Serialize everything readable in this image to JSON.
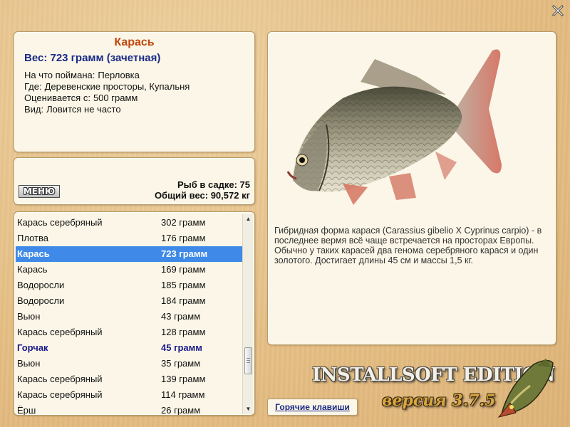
{
  "info": {
    "fish_name": "Карась",
    "weight_line": "Вес: 723 грамм (зачетная)",
    "details": [
      {
        "label": "На что поймана:",
        "value": "Перловка"
      },
      {
        "label": "Где:",
        "value": "Деревенские просторы, Купальня"
      },
      {
        "label": "Оценивается с:",
        "value": "500 грамм"
      },
      {
        "label": "Вид:",
        "value": "Ловится не часто"
      }
    ]
  },
  "stats": {
    "menu_label": "МЕНЮ",
    "keep_net": "Рыб в садке: 75",
    "total_weight": "Общий вес: 90,572 кг"
  },
  "catch_list": [
    {
      "name": "Карась серебряный",
      "weight": "302 грамм",
      "style": "normal"
    },
    {
      "name": "Плотва",
      "weight": "176 грамм",
      "style": "normal"
    },
    {
      "name": "Карась",
      "weight": "723 грамм",
      "style": "selected"
    },
    {
      "name": "Карась",
      "weight": "169 грамм",
      "style": "normal"
    },
    {
      "name": "Водоросли",
      "weight": "185 грамм",
      "style": "normal"
    },
    {
      "name": "Водоросли",
      "weight": "184 грамм",
      "style": "normal"
    },
    {
      "name": "Вьюн",
      "weight": "43 грамм",
      "style": "normal"
    },
    {
      "name": "Карась серебряный",
      "weight": "128 грамм",
      "style": "normal"
    },
    {
      "name": "Горчак",
      "weight": "45 грамм",
      "style": "bold"
    },
    {
      "name": "Вьюн",
      "weight": "35 грамм",
      "style": "normal"
    },
    {
      "name": "Карась серебряный",
      "weight": "139 грамм",
      "style": "normal"
    },
    {
      "name": "Карась серебряный",
      "weight": "114 грамм",
      "style": "normal"
    },
    {
      "name": "Ёрш",
      "weight": "26 грамм",
      "style": "normal"
    }
  ],
  "description": "Гибридная форма карася (Carassius gibelio X Cyprinus carpio) - в последнее вермя всё чаще встречается на просторах Европы. Обычно у таких карасей два генома серебряного карася и один золотого. Достигает длины 45 см и массы 1,5 кг.",
  "buttons": {
    "hotkeys": "Горячие клавиши"
  },
  "branding": {
    "title": "INSTALLSOFT EDITION",
    "version": "версия 3.7.5"
  },
  "colors": {
    "background": "#e7c48c",
    "panel": "#fbf6e7",
    "title_orange": "#c0480e",
    "weight_blue": "#1a2a88",
    "selection_blue": "#3f8ae8"
  },
  "icons": {
    "close": "close-x-icon",
    "fish_image": "crucian-carp-picture",
    "brand_fish": "pike-icon"
  }
}
